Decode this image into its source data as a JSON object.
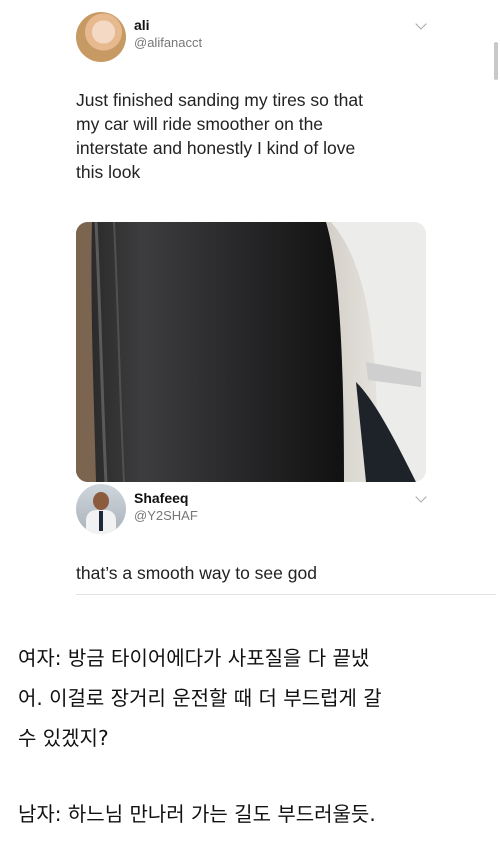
{
  "tweet_1": {
    "name": "ali",
    "handle": "@alifanacct",
    "text_lines": [
      "Just finished sanding my tires so that",
      "my car will ride smoother on the",
      "interstate and honestly I kind of love",
      "this look"
    ],
    "avatar_icon": "profile-photo-icon",
    "menu_icon": "chevron-down-icon",
    "media_icon": "worn-tire-photo"
  },
  "tweet_2": {
    "name": "Shafeeq",
    "handle": "@Y2SHAF",
    "text": "that’s a smooth way to see god",
    "avatar_icon": "profile-photo-icon",
    "menu_icon": "chevron-down-icon"
  },
  "caption": {
    "lines_woman": [
      "여자: 방금 타이어에다가 사포질을 다 끝냈",
      "어. 이걸로 장거리 운전할 때 더 부드럽게 갈",
      "수 있겠지?"
    ],
    "line_man": "남자: 하느님 만나러 가는 길도 부드러울듯."
  }
}
